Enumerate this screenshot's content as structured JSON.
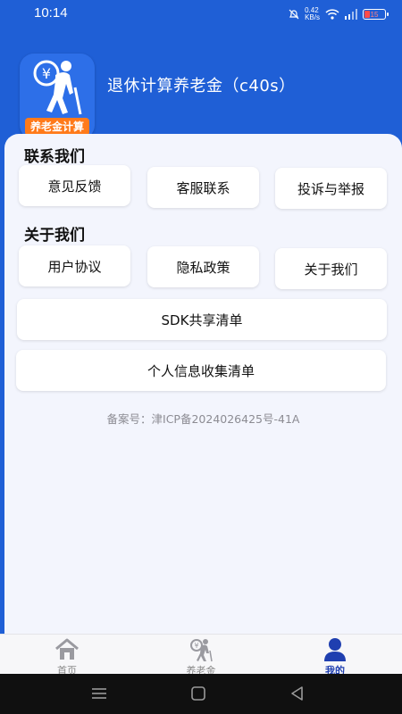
{
  "status_bar": {
    "time": "10:14",
    "network_speed_value": "0.42",
    "network_speed_unit": "KB/s",
    "battery": "15"
  },
  "header": {
    "app_title": "退休计算养老金（c40s）",
    "logo_text": "养老金计算"
  },
  "contact_section": {
    "title": "联系我们",
    "buttons": [
      {
        "label": "意见反馈"
      },
      {
        "label": "客服联系"
      },
      {
        "label": "投诉与举报"
      }
    ]
  },
  "about_section": {
    "title": "关于我们",
    "buttons": [
      {
        "label": "用户协议"
      },
      {
        "label": "隐私政策"
      },
      {
        "label": "关于我们"
      }
    ],
    "sdk_list": "SDK共享清单",
    "personal_info_list": "个人信息收集清单"
  },
  "icp": "备案号：津ICP备2024026425号-41A",
  "tabbar": {
    "tabs": [
      {
        "label": "首页",
        "icon": "home-icon",
        "active": false
      },
      {
        "label": "养老金",
        "icon": "pension-icon",
        "active": false
      },
      {
        "label": "我的",
        "icon": "profile-icon",
        "active": true
      }
    ],
    "active_color": "#1f3fb0"
  },
  "nav": {
    "icons": [
      "menu-icon",
      "home-square-icon",
      "back-triangle-icon"
    ]
  },
  "colors": {
    "header_bg": "#1f5fd6",
    "content_bg": "#f3f5fd",
    "logo_banner": "#ff7a1a"
  }
}
